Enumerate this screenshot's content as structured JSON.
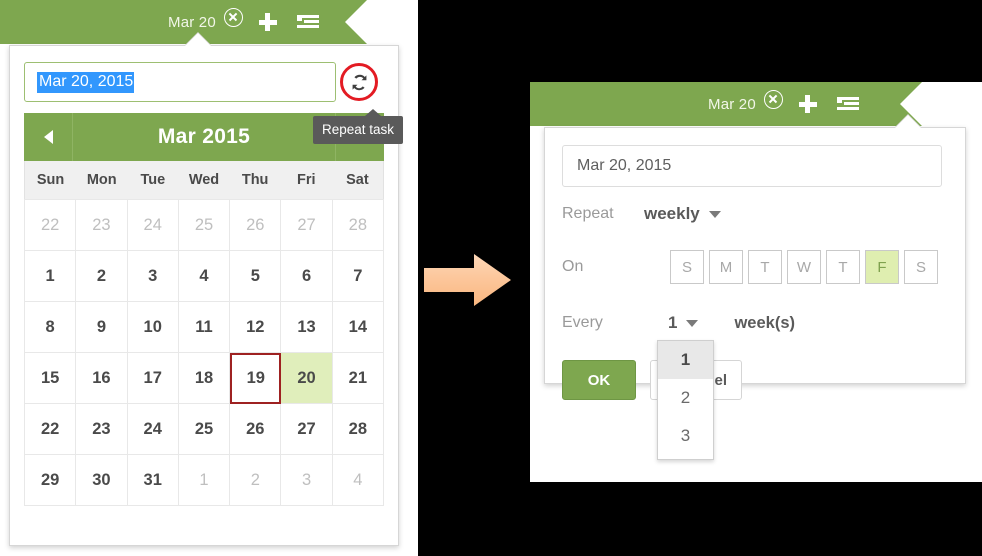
{
  "colors": {
    "brand_green": "#7EA74F",
    "selected_day_bg": "#E0EEBB",
    "today_border": "#9E2121",
    "annotation_ring": "#E31B23",
    "arrow": "#FBC79A",
    "text_selection": "#3297FD",
    "tooltip_bg": "#5A5A5A"
  },
  "left": {
    "banner": {
      "date_label": "Mar 20",
      "close_icon": "circle-x-icon",
      "add_icon": "plus-icon",
      "list_icon": "indent-list-icon"
    },
    "date_field": {
      "value": "Mar 20, 2015",
      "selected": true
    },
    "repeat_button": {
      "icon": "repeat-sync-icon",
      "tooltip": "Repeat task"
    },
    "calendar": {
      "prev_label": "◀",
      "next_label": "▶",
      "title": "Mar 2015",
      "weekdays": [
        "Sun",
        "Mon",
        "Tue",
        "Wed",
        "Thu",
        "Fri",
        "Sat"
      ],
      "weeks": [
        [
          {
            "d": "22",
            "state": "other"
          },
          {
            "d": "23",
            "state": "other"
          },
          {
            "d": "24",
            "state": "other"
          },
          {
            "d": "25",
            "state": "other"
          },
          {
            "d": "26",
            "state": "other"
          },
          {
            "d": "27",
            "state": "other"
          },
          {
            "d": "28",
            "state": "other"
          }
        ],
        [
          {
            "d": "1",
            "state": ""
          },
          {
            "d": "2",
            "state": ""
          },
          {
            "d": "3",
            "state": ""
          },
          {
            "d": "4",
            "state": ""
          },
          {
            "d": "5",
            "state": ""
          },
          {
            "d": "6",
            "state": ""
          },
          {
            "d": "7",
            "state": ""
          }
        ],
        [
          {
            "d": "8",
            "state": ""
          },
          {
            "d": "9",
            "state": ""
          },
          {
            "d": "10",
            "state": ""
          },
          {
            "d": "11",
            "state": ""
          },
          {
            "d": "12",
            "state": ""
          },
          {
            "d": "13",
            "state": ""
          },
          {
            "d": "14",
            "state": ""
          }
        ],
        [
          {
            "d": "15",
            "state": ""
          },
          {
            "d": "16",
            "state": ""
          },
          {
            "d": "17",
            "state": ""
          },
          {
            "d": "18",
            "state": ""
          },
          {
            "d": "19",
            "state": "today"
          },
          {
            "d": "20",
            "state": "selected"
          },
          {
            "d": "21",
            "state": ""
          }
        ],
        [
          {
            "d": "22",
            "state": ""
          },
          {
            "d": "23",
            "state": ""
          },
          {
            "d": "24",
            "state": ""
          },
          {
            "d": "25",
            "state": ""
          },
          {
            "d": "26",
            "state": ""
          },
          {
            "d": "27",
            "state": ""
          },
          {
            "d": "28",
            "state": ""
          }
        ],
        [
          {
            "d": "29",
            "state": ""
          },
          {
            "d": "30",
            "state": ""
          },
          {
            "d": "31",
            "state": ""
          },
          {
            "d": "1",
            "state": "other"
          },
          {
            "d": "2",
            "state": "other"
          },
          {
            "d": "3",
            "state": "other"
          },
          {
            "d": "4",
            "state": "other"
          }
        ]
      ]
    }
  },
  "flow": {
    "arrow_icon": "right-arrow-icon"
  },
  "right": {
    "banner": {
      "date_label": "Mar 20",
      "close_icon": "circle-x-icon",
      "add_icon": "plus-icon",
      "list_icon": "indent-list-icon"
    },
    "date_field": {
      "value": "Mar 20, 2015"
    },
    "repeat_row": {
      "label": "Repeat",
      "value": "weekly"
    },
    "on_row": {
      "label": "On",
      "days": [
        {
          "label": "S",
          "selected": false
        },
        {
          "label": "M",
          "selected": false
        },
        {
          "label": "T",
          "selected": false
        },
        {
          "label": "W",
          "selected": false
        },
        {
          "label": "T",
          "selected": false
        },
        {
          "label": "F",
          "selected": true
        },
        {
          "label": "S",
          "selected": false
        }
      ]
    },
    "every_row": {
      "label": "Every",
      "value": "1",
      "unit": "week(s)"
    },
    "number_dropdown": {
      "options": [
        "1",
        "2",
        "3"
      ],
      "selected": "1"
    },
    "buttons": {
      "ok": "OK",
      "cancel": "el"
    }
  }
}
